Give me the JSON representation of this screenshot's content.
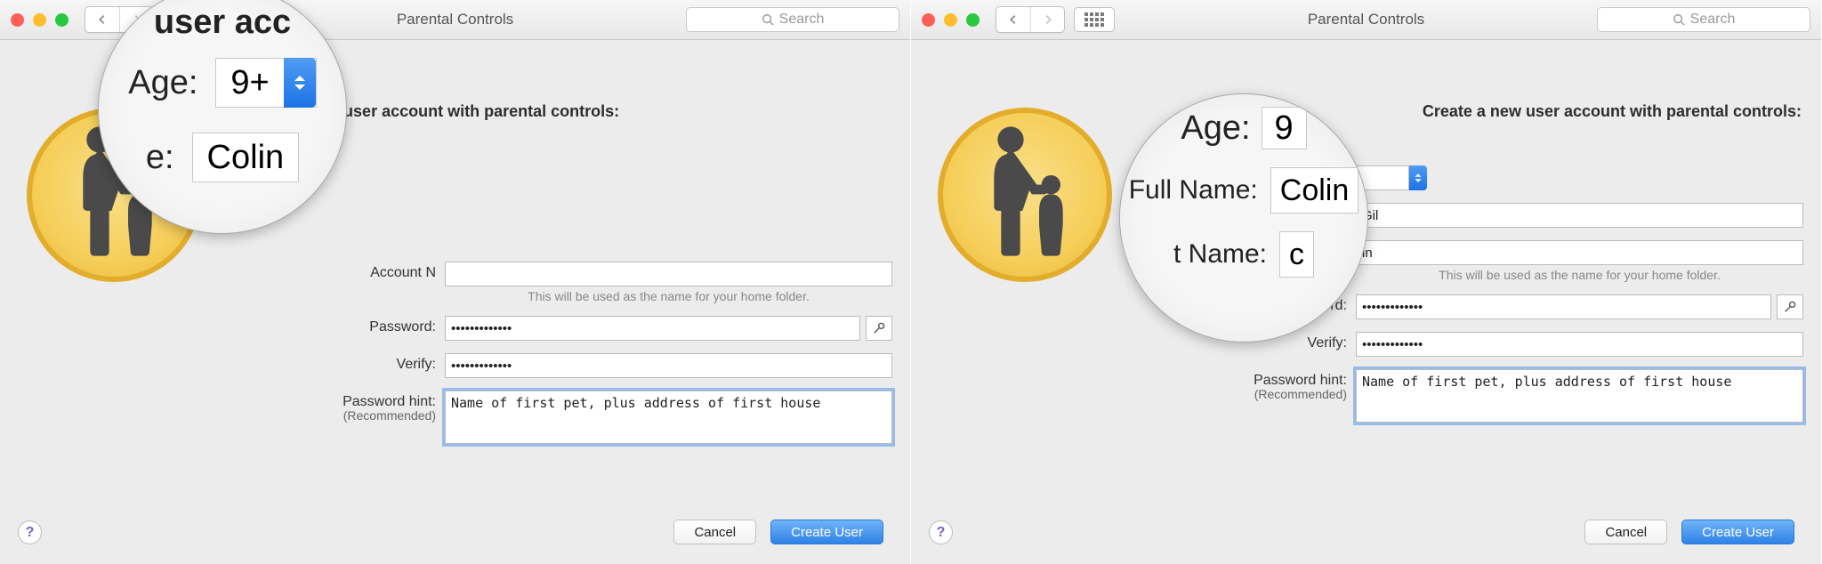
{
  "left": {
    "window_title": "Parental Controls",
    "search_placeholder": "Search",
    "heading": "Create a new user account with parental controls:",
    "magnifier": {
      "top_fragment": "user acc",
      "age_label": "Age:",
      "age_value": "9+",
      "lower_label_fragment": "e:",
      "lower_value_fragment": "Colin"
    },
    "account_name_label_fragment": "Account N",
    "account_name_helper": "This will be used as the name for your home folder.",
    "password_label": "Password:",
    "password_value": "•••••••••••••",
    "verify_label": "Verify:",
    "verify_value": "•••••••••••••",
    "hint_label": "Password hint:",
    "hint_sub": "(Recommended)",
    "hint_value": "Name of first pet, plus address of first house",
    "cancel": "Cancel",
    "create": "Create User"
  },
  "right": {
    "window_title": "Parental Controls",
    "search_placeholder": "Search",
    "heading": "Create a new user account with parental controls:",
    "magnifier": {
      "age_label": "Age:",
      "age_value_fragment": "9",
      "fullname_label": "Full Name:",
      "fullname_value_fragment": "Colin",
      "acct_label_fragment": "t Name:",
      "acct_value_fragment": "c"
    },
    "fullname_value_visible": "Gil",
    "account_name_value_visible": "in",
    "account_name_helper": "This will be used as the name for your home folder.",
    "password_label": "Password:",
    "password_value": "•••••••••••••",
    "verify_label": "Verify:",
    "verify_value": "•••••••••••••",
    "hint_label": "Password hint:",
    "hint_sub": "(Recommended)",
    "hint_value": "Name of first pet, plus address of first house",
    "cancel": "Cancel",
    "create": "Create User"
  }
}
